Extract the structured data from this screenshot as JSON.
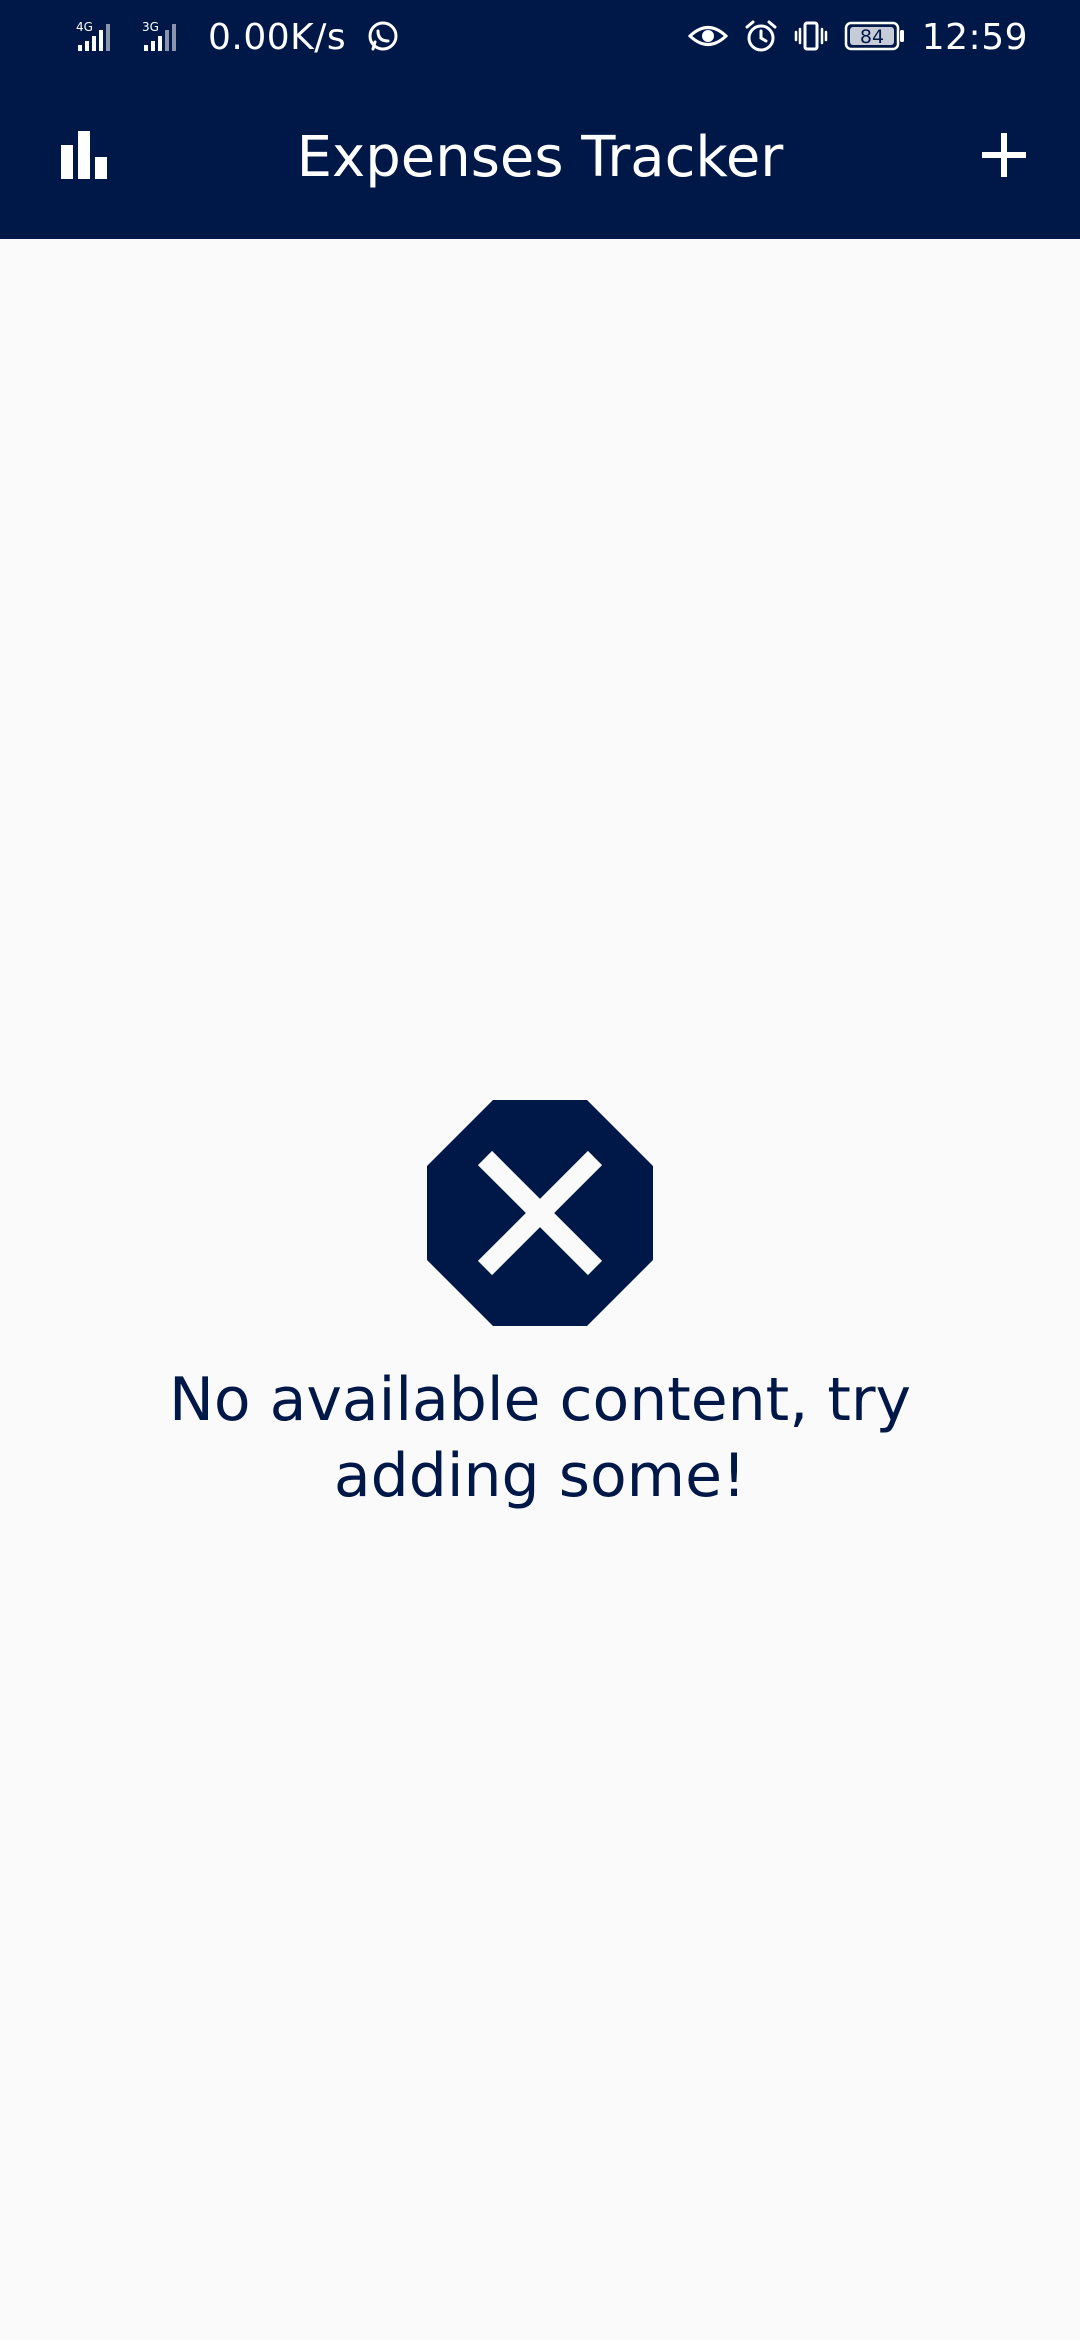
{
  "status_bar": {
    "network_1": "4G",
    "network_2": "3G",
    "speed": "0.00K/s",
    "battery": "84",
    "time": "12:59",
    "icons": [
      "signal-icon",
      "signal-icon",
      "whatsapp-icon",
      "eye-icon",
      "alarm-icon",
      "vibrate-icon",
      "battery-icon"
    ]
  },
  "app_bar": {
    "title": "Expenses Tracker",
    "left_icon": "bar-chart-icon",
    "right_icon": "plus-icon"
  },
  "empty_state": {
    "icon": "error-octagon-icon",
    "message": "No available content, try adding some!"
  },
  "colors": {
    "primary": "#001847",
    "background": "#fafafa",
    "on_primary": "#ffffff"
  }
}
